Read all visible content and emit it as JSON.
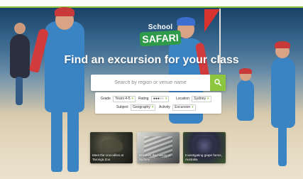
{
  "logo": {
    "line1": "School",
    "line2": "SAFARI"
  },
  "headline": "Find an excursion for your class",
  "search": {
    "placeholder": "Search by region or venue name",
    "button_icon": "search-icon"
  },
  "filters": {
    "grade": {
      "label": "Grade",
      "value": "Years 4-5"
    },
    "rating": {
      "label": "Rating",
      "value": "●●●○○"
    },
    "location": {
      "label": "Location",
      "value": "Sydney"
    },
    "subject": {
      "label": "Subject",
      "value": "Geography"
    },
    "activity": {
      "label": "Activity",
      "value": "Excursion"
    }
  },
  "cards": [
    {
      "title": "Meet the crocodiles at Taronga Zoo"
    },
    {
      "title": "Discover the history of Sydney"
    },
    {
      "title": "Investigating grape farms, Australia"
    }
  ],
  "colors": {
    "accent": "#8cc63f",
    "logo_green": "#2f9a4a",
    "flag_red": "#d8332f"
  }
}
